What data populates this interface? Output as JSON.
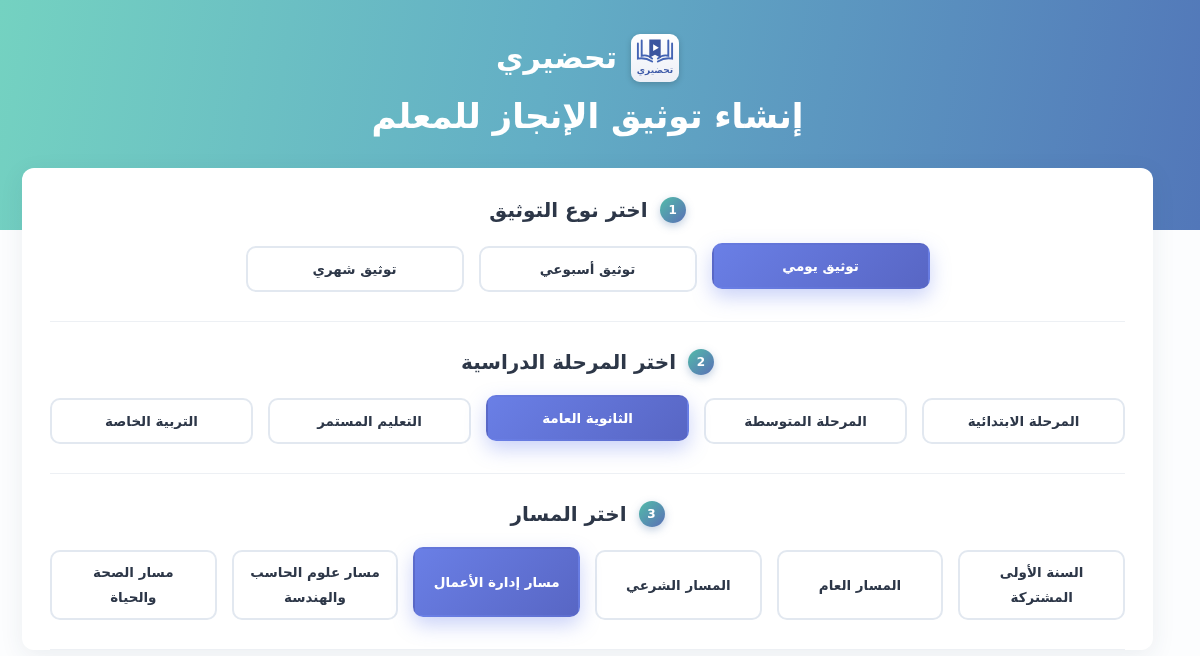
{
  "header": {
    "logo_caption": "تحضيري",
    "brand": "تحضيري",
    "title": "إنشاء توثيق الإنجاز للمعلم"
  },
  "sections": [
    {
      "number": "1",
      "title": "اختر نوع التوثيق",
      "options": [
        {
          "label": "توثيق يومي",
          "selected": true
        },
        {
          "label": "توثيق أسبوعي",
          "selected": false
        },
        {
          "label": "توثيق شهري",
          "selected": false
        }
      ]
    },
    {
      "number": "2",
      "title": "اختر المرحلة الدراسية",
      "options": [
        {
          "label": "المرحلة الابتدائية",
          "selected": false
        },
        {
          "label": "المرحلة المتوسطة",
          "selected": false
        },
        {
          "label": "الثانوية العامة",
          "selected": true
        },
        {
          "label": "التعليم المستمر",
          "selected": false
        },
        {
          "label": "التربية الخاصة",
          "selected": false
        }
      ]
    },
    {
      "number": "3",
      "title": "اختر المسار",
      "options": [
        {
          "label": "السنة الأولى\nالمشتركة",
          "selected": false
        },
        {
          "label": "المسار العام",
          "selected": false
        },
        {
          "label": "المسار الشرعي",
          "selected": false
        },
        {
          "label": "مسار إدارة الأعمال",
          "selected": true
        },
        {
          "label": "مسار علوم الحاسب\nوالهندسة",
          "selected": false
        },
        {
          "label": "مسار الصحة\nوالحياة",
          "selected": false
        }
      ]
    }
  ]
}
